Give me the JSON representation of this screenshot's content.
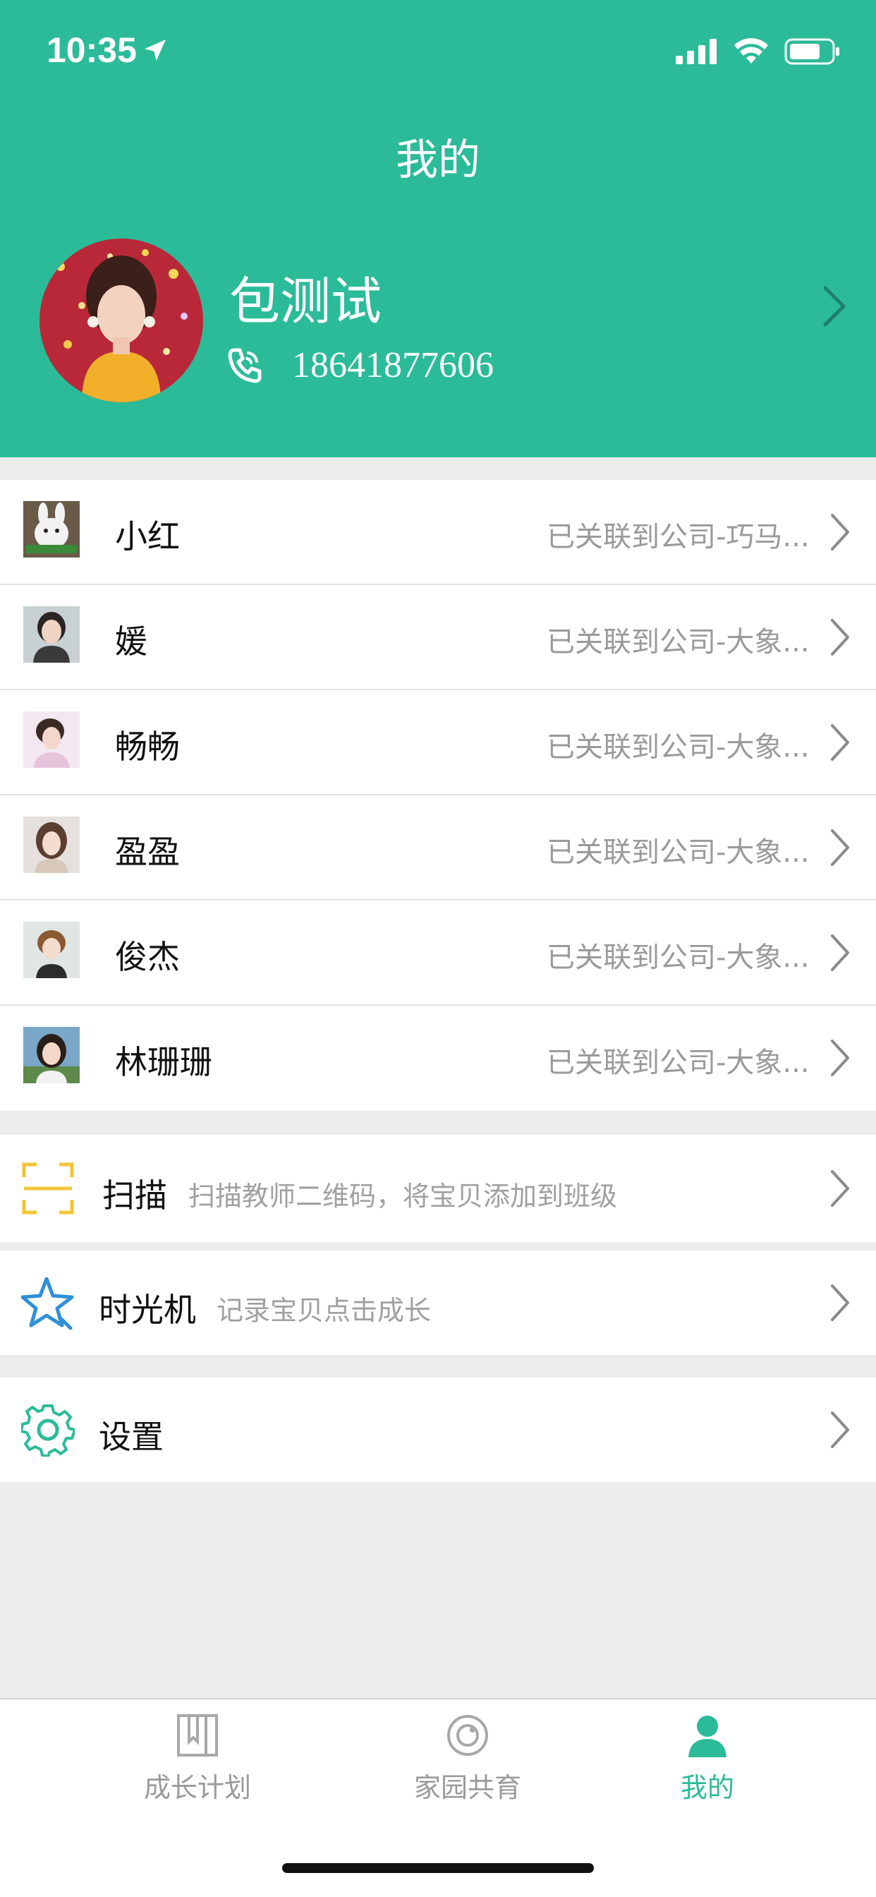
{
  "status_bar": {
    "time": "10:35"
  },
  "header": {
    "title": "我的",
    "profile": {
      "name": "包测试",
      "phone": "18641877606"
    }
  },
  "children": [
    {
      "name": "小红",
      "status": "已关联到公司-巧马...",
      "thumb": "thumb-bunny"
    },
    {
      "name": "媛",
      "status": "已关联到公司-大象...",
      "thumb": "thumb-girl-selfie"
    },
    {
      "name": "畅畅",
      "status": "已关联到公司-大象...",
      "thumb": "thumb-girl-pink"
    },
    {
      "name": "盈盈",
      "status": "已关联到公司-大象...",
      "thumb": "thumb-girl-portrait"
    },
    {
      "name": "俊杰",
      "status": "已关联到公司-大象...",
      "thumb": "thumb-boy"
    },
    {
      "name": "林珊珊",
      "status": "已关联到公司-大象...",
      "thumb": "thumb-girl-outdoor"
    }
  ],
  "menu": {
    "scan": {
      "label": "扫描",
      "desc": "扫描教师二维码，将宝贝添加到班级",
      "icon": "scan-icon"
    },
    "time_machine": {
      "label": "时光机",
      "desc": "记录宝贝点击成长",
      "icon": "star-icon"
    },
    "settings": {
      "label": "设置",
      "icon": "gear-icon"
    }
  },
  "tabbar": {
    "tabs": [
      {
        "label": "成长计划",
        "icon": "bookmark-book-icon",
        "active": false
      },
      {
        "label": "家园共育",
        "icon": "circle-icon",
        "active": false
      },
      {
        "label": "我的",
        "icon": "person-icon",
        "active": true
      }
    ]
  },
  "colors": {
    "accent": "#2bbb99",
    "scan_icon": "#f3c436",
    "star_icon": "#2f8fd8",
    "gear_icon": "#2bbb99",
    "inactive_tab": "#9a9a9a"
  }
}
